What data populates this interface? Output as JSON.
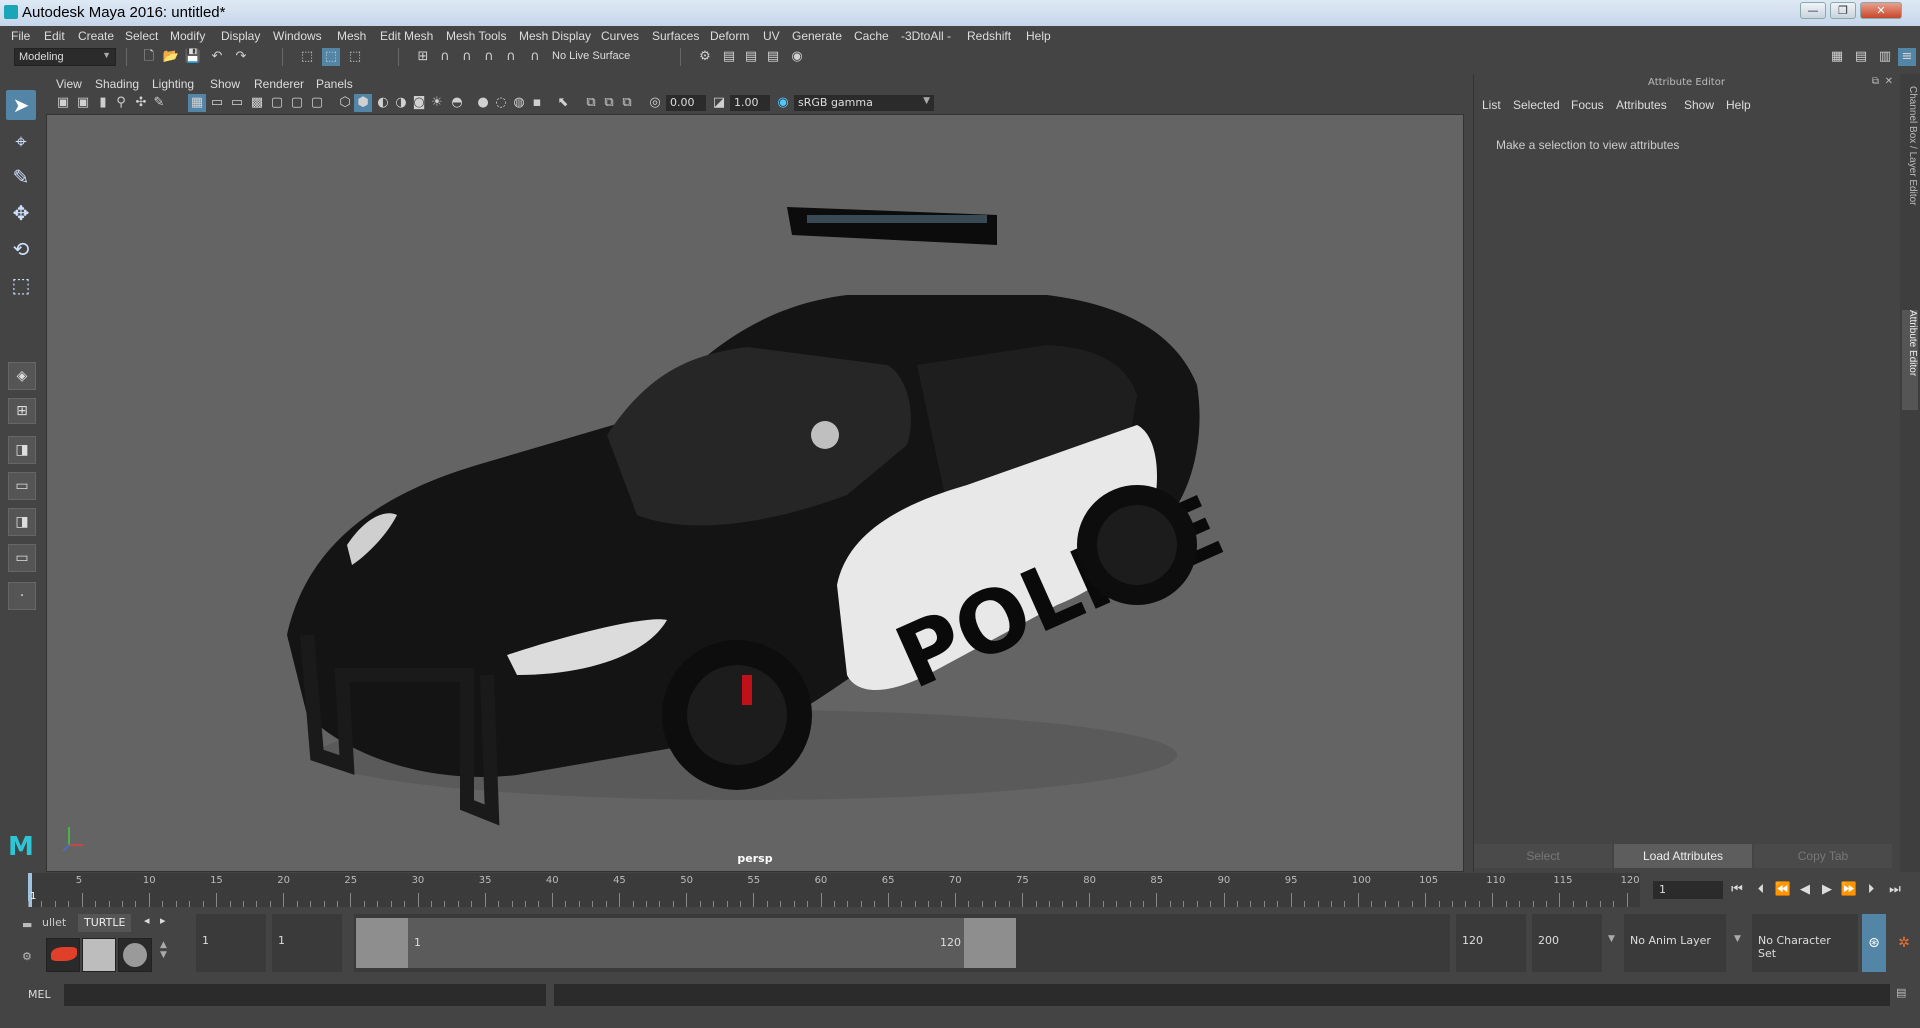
{
  "window": {
    "title": "Autodesk Maya 2016: untitled*"
  },
  "menu": [
    "File",
    "Edit",
    "Create",
    "Select",
    "Modify",
    "Display",
    "Windows",
    "Mesh",
    "Edit Mesh",
    "Mesh Tools",
    "Mesh Display",
    "Curves",
    "Surfaces",
    "Deform",
    "UV",
    "Generate",
    "Cache",
    "-3DtoAll -",
    "Redshift",
    "Help"
  ],
  "toolbar": {
    "menuset": "Modeling",
    "live_surface": "No Live Surface"
  },
  "viewport": {
    "menu": [
      "View",
      "Shading",
      "Lighting",
      "Show",
      "Renderer",
      "Panels"
    ],
    "exposure": "0.00",
    "gamma": "1.00",
    "color_space": "sRGB gamma",
    "camera": "persp",
    "model_text": "POLICE"
  },
  "attribute_editor": {
    "title": "Attribute Editor",
    "menu": [
      "List",
      "Selected",
      "Focus",
      "Attributes",
      "Show",
      "Help"
    ],
    "message": "Make a selection to view attributes",
    "buttons": {
      "select": "Select",
      "load": "Load Attributes",
      "copy": "Copy Tab"
    },
    "side_tabs": {
      "channel_box": "Channel Box / Layer Editor",
      "attribute_editor": "Attribute Editor"
    }
  },
  "timeline": {
    "labels": [
      "5",
      "10",
      "15",
      "20",
      "25",
      "30",
      "35",
      "40",
      "45",
      "50",
      "55",
      "60",
      "65",
      "70",
      "75",
      "80",
      "85",
      "90",
      "95",
      "100",
      "105",
      "110",
      "115",
      "120"
    ],
    "start_label": "1",
    "current_frame": "1"
  },
  "range": {
    "shelf_tabs": [
      "ullet",
      "TURTLE"
    ],
    "start": "1",
    "playback_start": "1",
    "slider_start": "1",
    "slider_end": "120",
    "playback_end": "120",
    "end": "200",
    "anim_layer": "No Anim Layer",
    "character_set": "No Character Set"
  },
  "command_line": {
    "label": "MEL"
  }
}
